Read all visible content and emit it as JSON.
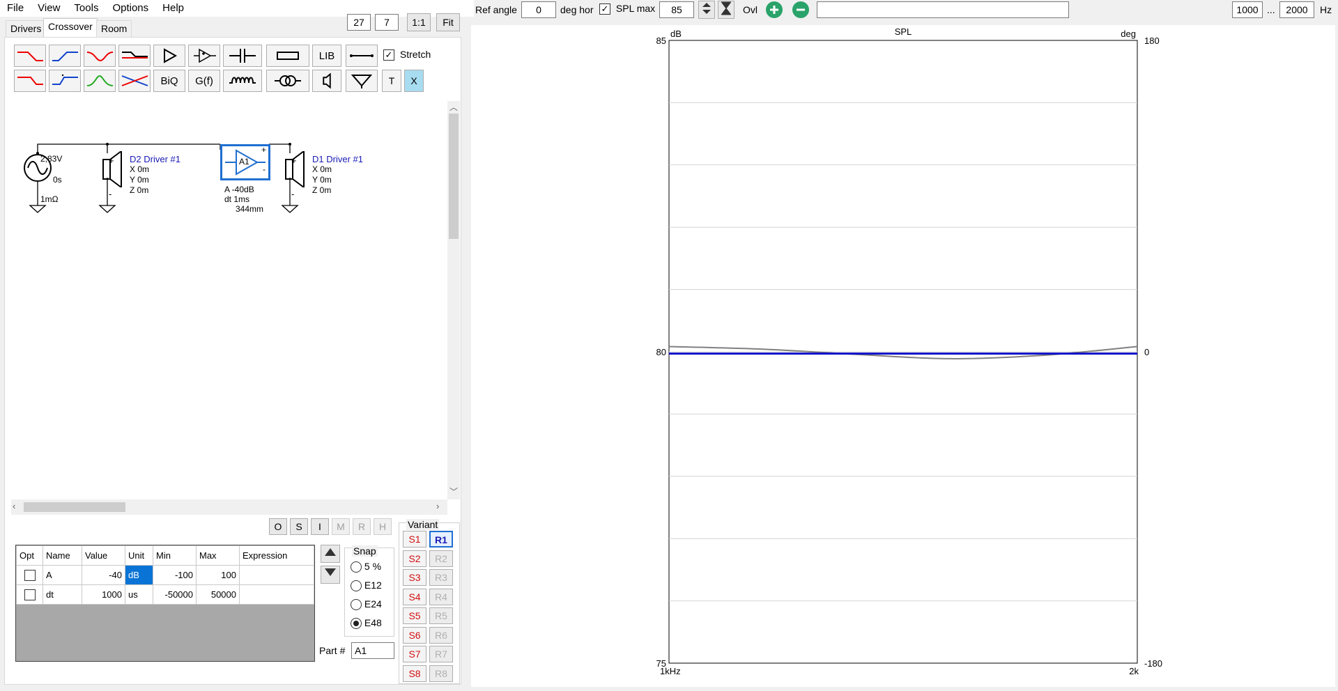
{
  "menu": [
    "File",
    "View",
    "Tools",
    "Options",
    "Help"
  ],
  "tabs": [
    "Drivers",
    "Crossover",
    "Room"
  ],
  "view_controls": {
    "zoom1": "27",
    "zoom2": "7",
    "one_to_one": "1:1",
    "fit": "Fit"
  },
  "toolbar": {
    "lib": "LIB",
    "stretch_label": "Stretch",
    "stretch_checked": true,
    "biq": "BiQ",
    "gf": "G(f)",
    "t": "T",
    "x": "X"
  },
  "schematic": {
    "source": {
      "voltage": "2,83V",
      "delay": "0s",
      "resistance": "1mΩ"
    },
    "driver2": {
      "name": "D2 Driver #1",
      "x": "X 0m",
      "y": "Y 0m",
      "z": "Z 0m"
    },
    "amp": {
      "label": "A1",
      "gain": "A  -40dB",
      "dt": "dt 1ms",
      "dist": "344mm"
    },
    "driver1": {
      "name": "D1 Driver #1",
      "x": "X 0m",
      "y": "Y 0m",
      "z": "Z 0m"
    }
  },
  "part_buttons": [
    "O",
    "S",
    "I",
    "M",
    "R",
    "H"
  ],
  "params": {
    "headers": [
      "Opt",
      "Name",
      "Value",
      "Unit",
      "Min",
      "Max",
      "Expression"
    ],
    "rows": [
      {
        "name": "A",
        "value": "-40",
        "unit": "dB",
        "min": "-100",
        "max": "100",
        "expr": ""
      },
      {
        "name": "dt",
        "value": "1000",
        "unit": "us",
        "min": "-50000",
        "max": "50000",
        "expr": ""
      }
    ]
  },
  "snap": {
    "title": "Snap",
    "options": [
      "5 %",
      "E12",
      "E24",
      "E48"
    ],
    "selected": "E48"
  },
  "part_number": {
    "label": "Part #",
    "value": "A1"
  },
  "variant": {
    "title": "Variant",
    "s": [
      "S1",
      "S2",
      "S3",
      "S4",
      "S5",
      "S6",
      "S7",
      "S8"
    ],
    "r": [
      "R1",
      "R2",
      "R3",
      "R4",
      "R5",
      "R6",
      "R7",
      "R8"
    ],
    "active_r": "R1"
  },
  "top": {
    "ref_angle_label": "Ref angle",
    "ref_angle_value": "0",
    "deg_hor": "deg hor",
    "spl_max_label": "SPL max",
    "spl_max_checked": true,
    "spl_max_value": "85",
    "ovl": "Ovl",
    "text_value": "",
    "f_min": "1000",
    "ellipsis": "...",
    "f_max": "2000",
    "hz": "Hz"
  },
  "chart_data": {
    "type": "line",
    "title": "SPL",
    "ylabel": "dB",
    "y2label": "deg",
    "xlim": [
      1000,
      2000
    ],
    "ylim": [
      75,
      85
    ],
    "y2lim": [
      -180,
      180
    ],
    "x_tick_labels": [
      "1kHz",
      "2k"
    ],
    "y_tick_labels": [
      "85",
      "80",
      "75"
    ],
    "y2_tick_labels": [
      "180",
      "0",
      "-180"
    ],
    "grid": true,
    "series": [
      {
        "name": "SPL",
        "color": "#1010c8",
        "x": [
          1000,
          1250,
          1500,
          1750,
          2000
        ],
        "y": [
          79.97,
          79.97,
          79.97,
          79.97,
          79.97
        ]
      },
      {
        "name": "Phase",
        "color": "#808080",
        "axis": "y2",
        "x": [
          1000,
          1200,
          1400,
          1600,
          1800,
          2000
        ],
        "y": [
          3,
          1.5,
          -1.5,
          -4,
          -2,
          3
        ]
      }
    ]
  }
}
